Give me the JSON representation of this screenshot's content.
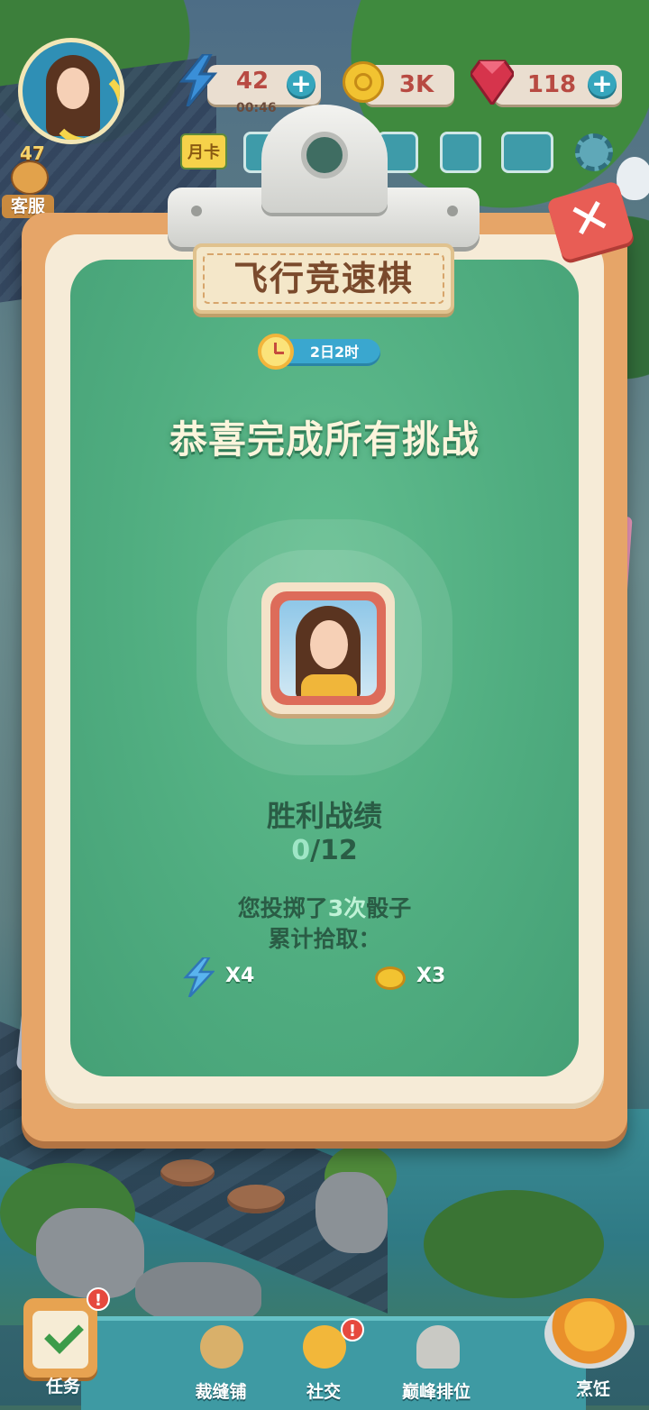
{
  "hud": {
    "level": "47",
    "customer_service_label": "客服",
    "energy": {
      "value": "42",
      "timer": "00:46",
      "plus": "+"
    },
    "coins": {
      "value": "3K"
    },
    "gems": {
      "value": "118",
      "plus": "+"
    },
    "month_card_label": "月卡"
  },
  "modal": {
    "title": "飞行竞速棋",
    "close_glyph": "✕",
    "countdown": "2日2时",
    "headline": "恭喜完成所有挑战",
    "stats": {
      "label": "胜利战绩",
      "wins": "0",
      "total": "/12"
    },
    "dice_prefix": "您投掷了",
    "dice_count": "3次",
    "dice_suffix": "骰子",
    "collected_label": "累计拾取：",
    "rewards": [
      {
        "icon": "lightning-icon",
        "amount": "X4"
      },
      {
        "icon": "coin-icon",
        "amount": "X3"
      }
    ]
  },
  "nav": {
    "items": [
      {
        "label": "任务",
        "icon": "task-board-icon",
        "alert": "!"
      },
      {
        "label": "裁缝铺",
        "icon": "sewing-icon"
      },
      {
        "label": "社交",
        "icon": "social-icon",
        "alert": "!"
      },
      {
        "label": "巅峰排位",
        "icon": "trophy-locked-icon"
      },
      {
        "label": "烹饪",
        "icon": "cooking-pot-icon"
      }
    ]
  },
  "colors": {
    "board_wood": "#e6a568",
    "felt_green": "#50ad80",
    "close_red": "#e85d55",
    "nav_teal": "#3e9aa3"
  }
}
